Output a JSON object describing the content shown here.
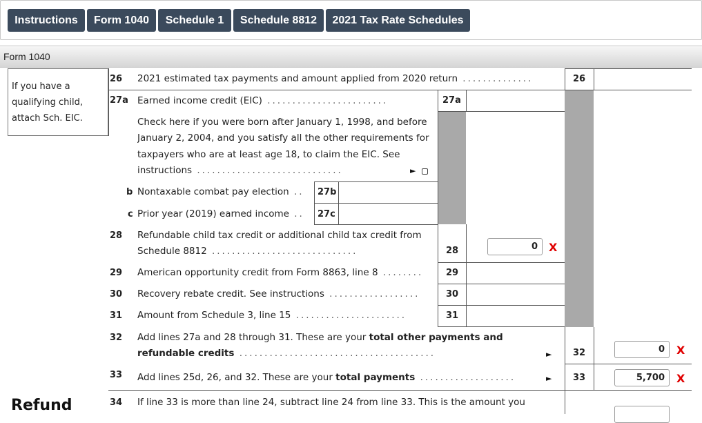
{
  "tabs": [
    "Instructions",
    "Form 1040",
    "Schedule 1",
    "Schedule 8812",
    "2021 Tax Rate Schedules"
  ],
  "section_title": "Form 1040",
  "side_note": {
    "line1": "If you have a",
    "line2": "qualifying child,",
    "line3": "attach Sch. EIC."
  },
  "lines": {
    "l26": {
      "num": "26",
      "text": "2021 estimated tax payments and amount applied from 2020 return",
      "box": "26"
    },
    "l27a": {
      "num": "27a",
      "text": "Earned income credit (EIC)",
      "box": "27a"
    },
    "l27a_check": {
      "line1": "Check here if you were born after January 1, 1998, and before",
      "line2": "January 2, 2004, and you satisfy all the other requirements for",
      "line3": "taxpayers who are at least age 18, to claim the EIC. See",
      "line4": "instructions"
    },
    "l27b": {
      "num": "b",
      "text": "Nontaxable combat pay election",
      "box": "27b"
    },
    "l27c": {
      "num": "c",
      "text": "Prior year (2019) earned income",
      "box": "27c"
    },
    "l28": {
      "num": "28",
      "line1": "Refundable child tax credit or additional child tax credit from",
      "line2": "Schedule 8812",
      "box": "28",
      "value": "0"
    },
    "l29": {
      "num": "29",
      "text": "American opportunity credit from Form 8863, line 8",
      "box": "29"
    },
    "l30": {
      "num": "30",
      "text": "Recovery rebate credit. See instructions",
      "box": "30"
    },
    "l31": {
      "num": "31",
      "text": "Amount from Schedule 3, line 15",
      "box": "31"
    },
    "l32": {
      "num": "32",
      "line1_a": "Add lines 27a and 28 through 31. These are your ",
      "line1_b": "total other payments and",
      "line2": "refundable credits",
      "box": "32",
      "value": "0"
    },
    "l33": {
      "num": "33",
      "text_a": "Add lines 25d, 26, and 32. These are your ",
      "text_b": "total payments",
      "box": "33",
      "value": "5,700"
    },
    "l34": {
      "num": "34",
      "text": "If line 33 is more than line 24, subtract line 24 from line 33. This is the amount you"
    }
  },
  "refund_label": "Refund",
  "x_mark": "X",
  "check_arrow": "►"
}
